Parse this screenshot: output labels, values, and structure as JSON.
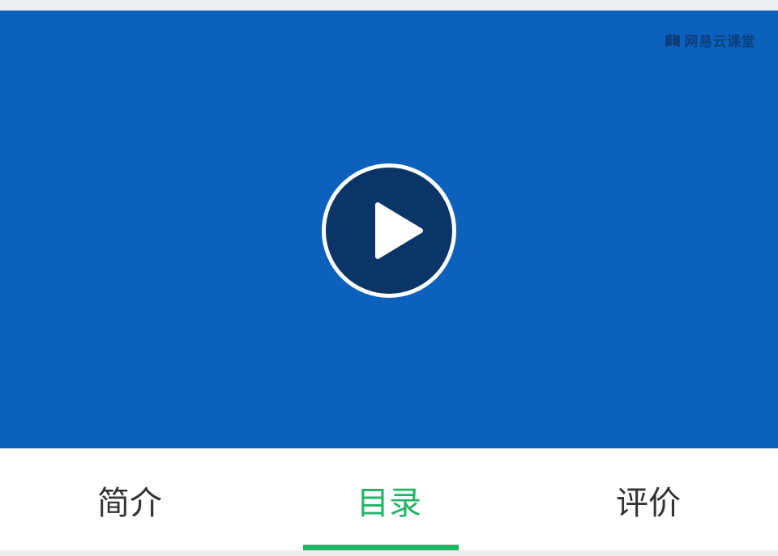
{
  "video": {
    "watermark_text": "网易云课堂",
    "watermark_icon": "book-logo-icon",
    "play_icon": "play-icon",
    "background_color": "#0b61bb"
  },
  "tabs": [
    {
      "label": "简介",
      "active": false
    },
    {
      "label": "目录",
      "active": true
    },
    {
      "label": "评价",
      "active": false
    }
  ],
  "colors": {
    "accent": "#22b365",
    "tab_text": "#333333"
  }
}
